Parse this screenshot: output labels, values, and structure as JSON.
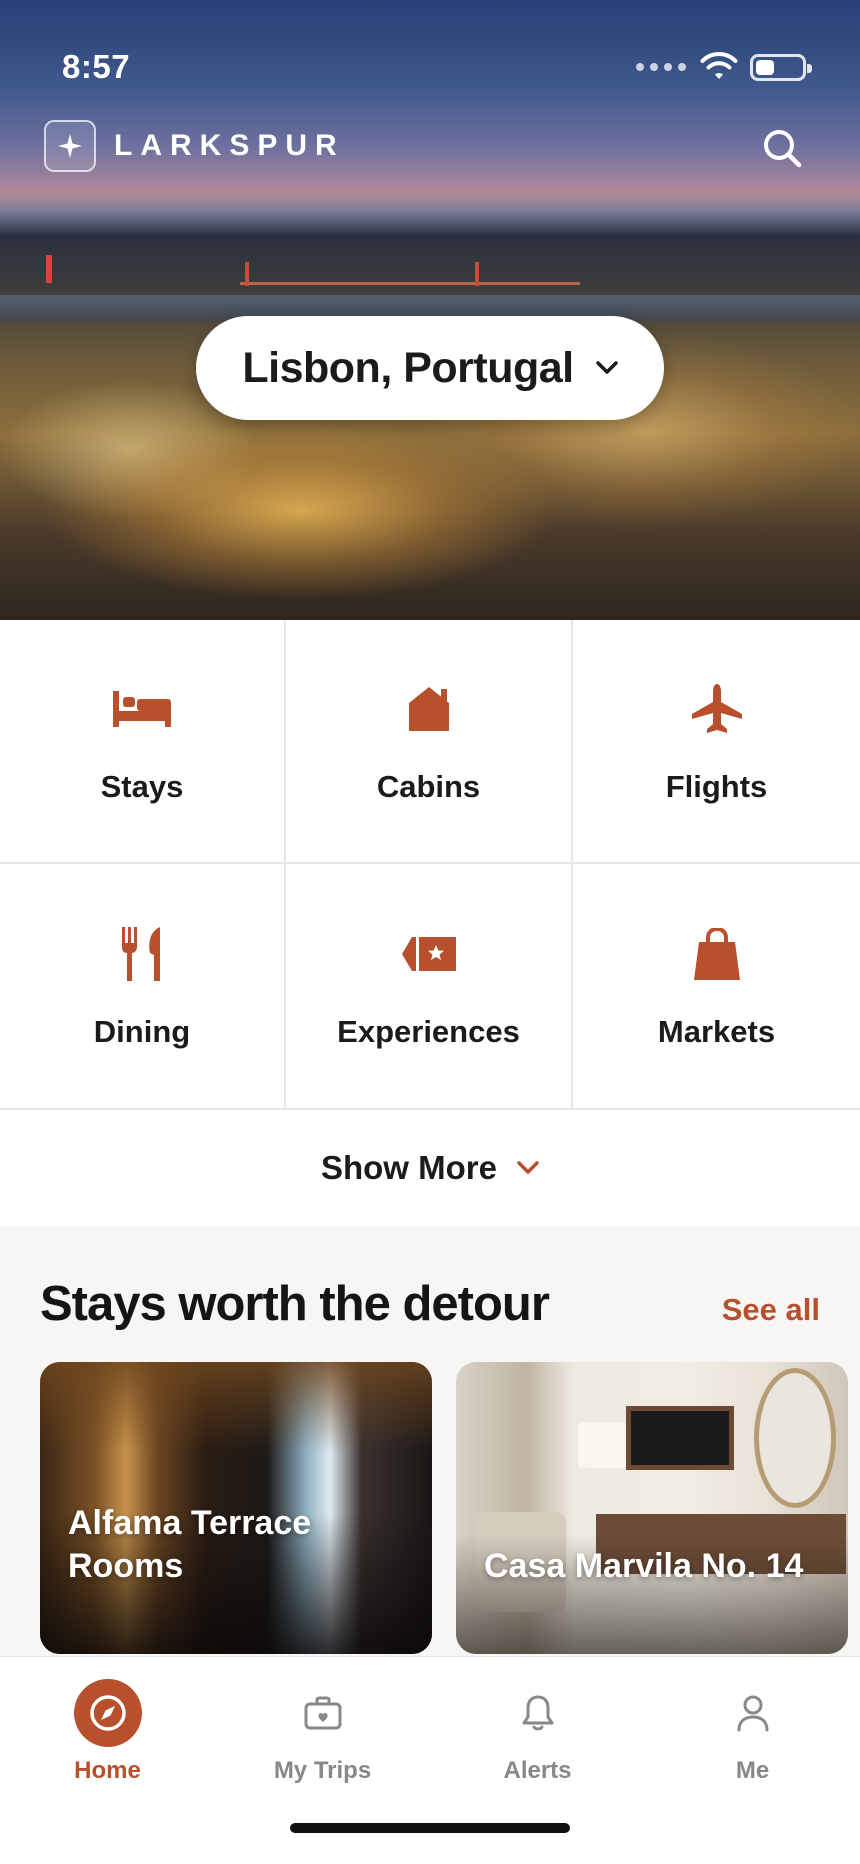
{
  "status_bar": {
    "time": "8:57"
  },
  "brand": {
    "name": "LARKSPUR"
  },
  "location": {
    "value": "Lisbon, Portugal"
  },
  "categories": [
    {
      "label": "Stays",
      "icon": "bed-icon"
    },
    {
      "label": "Cabins",
      "icon": "cabin-icon"
    },
    {
      "label": "Flights",
      "icon": "airplane-icon"
    },
    {
      "label": "Dining",
      "icon": "fork-knife-icon"
    },
    {
      "label": "Experiences",
      "icon": "ticket-icon"
    },
    {
      "label": "Markets",
      "icon": "shopping-bag-icon"
    }
  ],
  "show_more": {
    "label": "Show More"
  },
  "stays_section": {
    "title": "Stays worth the detour",
    "see_all": "See all",
    "cards": [
      {
        "title": "Alfama Terrace Rooms"
      },
      {
        "title": "Casa Marvila No. 14"
      }
    ]
  },
  "tabbar": {
    "tabs": [
      {
        "label": "Home",
        "icon": "compass-icon",
        "active": true
      },
      {
        "label": "My Trips",
        "icon": "suitcase-icon",
        "active": false
      },
      {
        "label": "Alerts",
        "icon": "bell-icon",
        "active": false
      },
      {
        "label": "Me",
        "icon": "person-icon",
        "active": false
      }
    ]
  },
  "colors": {
    "accent": "#b8502e",
    "text": "#1d1b19",
    "muted": "#8a8784",
    "section_bg": "#f7f6f4"
  }
}
